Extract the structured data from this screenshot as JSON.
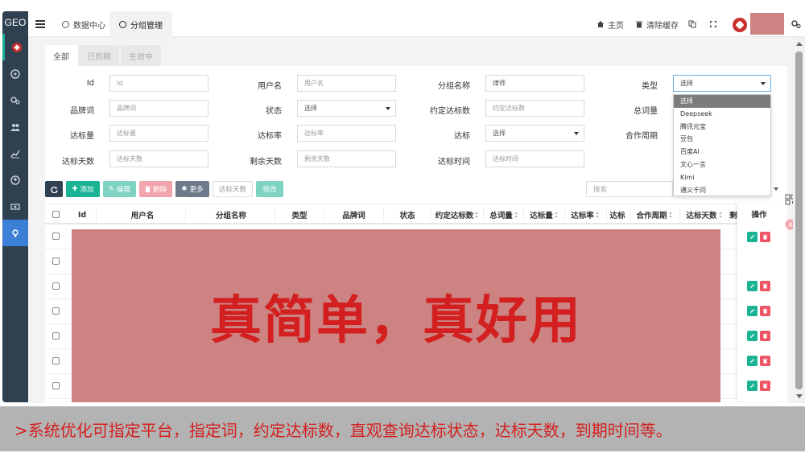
{
  "sidebar": {
    "logo": "GEO"
  },
  "topbar": {
    "tabs": [
      {
        "label": "数据中心"
      },
      {
        "label": "分组管理"
      }
    ],
    "home": "主页",
    "clear_cache": "清除缓存"
  },
  "status_tabs": [
    "全部",
    "已到期",
    "生效中"
  ],
  "form": {
    "id": {
      "label": "Id",
      "placeholder": "Id"
    },
    "username": {
      "label": "用户名",
      "placeholder": "用户名"
    },
    "group_name": {
      "label": "分组名称",
      "value": "律师"
    },
    "type": {
      "label": "类型",
      "value": "选择"
    },
    "brand_word": {
      "label": "品牌词",
      "placeholder": "品牌词"
    },
    "status": {
      "label": "状态",
      "value": "选择"
    },
    "agreed_count": {
      "label": "约定达标数",
      "placeholder": "约定达标数"
    },
    "total_words": {
      "label": "总词量"
    },
    "reach_count": {
      "label": "达标量",
      "placeholder": "达标量"
    },
    "reach_rate": {
      "label": "达标率",
      "placeholder": "达标率"
    },
    "reached": {
      "label": "达标",
      "value": "选择"
    },
    "coop_period": {
      "label": "合作周期"
    },
    "reach_days": {
      "label": "达标天数",
      "placeholder": "达标天数"
    },
    "remaining_days": {
      "label": "剩余天数",
      "placeholder": "剩余天数"
    },
    "reach_time": {
      "label": "达标时间",
      "placeholder": "达标时间"
    }
  },
  "type_options": [
    "选择",
    "Deepseek",
    "腾讯元宝",
    "豆包",
    "百度AI",
    "文心一言",
    "Kimi",
    "通义千问"
  ],
  "toolbar": {
    "add": "添加",
    "edit": "编辑",
    "delete": "删除",
    "more": "更多",
    "reach_days": "达标天数",
    "modify": "修改",
    "search_placeholder": "搜索"
  },
  "table": {
    "columns": [
      "Id",
      "用户名",
      "分组名称",
      "类型",
      "品牌词",
      "状态",
      "约定达标数",
      "总词量",
      "达标量",
      "达标率",
      "达标",
      "合作周期",
      "达标天数",
      "剩",
      "操作"
    ],
    "row_count": 7
  },
  "promo": "真简单，真好用",
  "caption": ">系统优化可指定平台，指定词，约定达标数，直观查询达标状态，达标天数，到期时间等。",
  "colors": {
    "sidebar": "#2f4050",
    "accent_green": "#1ab394",
    "danger_red": "#ed5565",
    "primary_blue": "#3c7fd6",
    "promo_bg": "#cc8381",
    "promo_text": "#d31f1f"
  }
}
